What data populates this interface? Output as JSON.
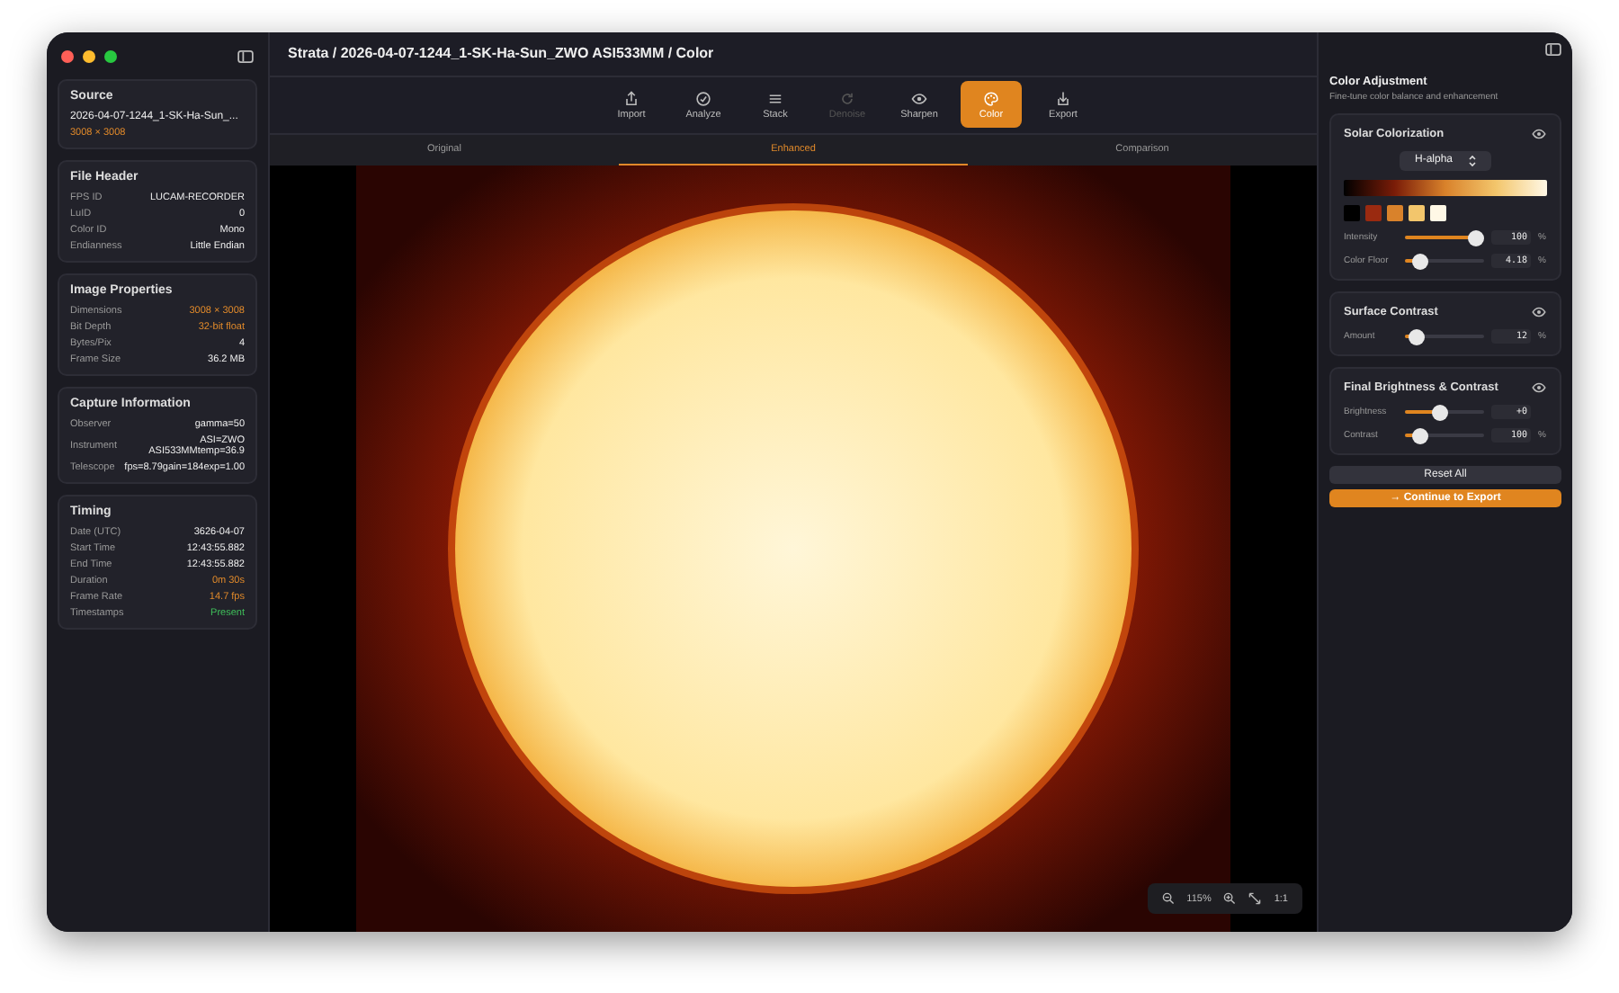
{
  "window": {
    "title": "Strata / 2026-04-07-1244_1-SK-Ha-Sun_ZWO ASI533MM / Color"
  },
  "sidebar": {
    "cards": [
      {
        "title": "Source",
        "file": "2026-04-07-1244_1-SK-Ha-Sun_...",
        "size": "3008 × 3008"
      },
      {
        "title": "File Header",
        "rows": [
          {
            "label": "FPS ID",
            "value": "LUCAM-RECORDER"
          },
          {
            "label": "LuID",
            "value": "0"
          },
          {
            "label": "Color ID",
            "value": "Mono"
          },
          {
            "label": "Endianness",
            "value": "Little Endian"
          }
        ]
      },
      {
        "title": "Image Properties",
        "rows": [
          {
            "label": "Dimensions",
            "value": "3008 × 3008",
            "color": "#e0892a"
          },
          {
            "label": "Bit Depth",
            "value": "32-bit float",
            "color": "#e0892a"
          },
          {
            "label": "Bytes/Pix",
            "value": "4"
          },
          {
            "label": "Frame Size",
            "value": "36.2 MB"
          }
        ]
      },
      {
        "title": "Capture Information",
        "rows": [
          {
            "label": "Observer",
            "value": "gamma=50"
          },
          {
            "label": "Instrument",
            "value": "ASI=ZWO ASI533MMtemp=36.9"
          },
          {
            "label": "Telescope",
            "value": "fps=8.79gain=184exp=1.00"
          }
        ]
      },
      {
        "title": "Timing",
        "rows": [
          {
            "label": "Date (UTC)",
            "value": "3626-04-07"
          },
          {
            "label": "Start Time",
            "value": "12:43:55.882"
          },
          {
            "label": "End Time",
            "value": "12:43:55.882"
          },
          {
            "label": "Duration",
            "value": "0m 30s",
            "color": "#e0892a"
          },
          {
            "label": "Frame Rate",
            "value": "14.7 fps",
            "color": "#e0892a"
          },
          {
            "label": "Timestamps",
            "value": "Present",
            "color": "#3fbf5a"
          }
        ]
      }
    ]
  },
  "toolbar": [
    {
      "label": "Import",
      "selected": false,
      "disabled": false
    },
    {
      "label": "Analyze",
      "selected": false,
      "disabled": false
    },
    {
      "label": "Stack",
      "selected": false,
      "disabled": false
    },
    {
      "label": "Denoise",
      "selected": false,
      "disabled": true
    },
    {
      "label": "Sharpen",
      "selected": false,
      "disabled": false
    },
    {
      "label": "Color",
      "selected": true,
      "disabled": false
    },
    {
      "label": "Export",
      "selected": false,
      "disabled": false
    }
  ],
  "view_tabs": [
    {
      "label": "Original",
      "selected": false
    },
    {
      "label": "Enhanced",
      "selected": true
    },
    {
      "label": "Comparison",
      "selected": false
    }
  ],
  "zoom_bar": {
    "zoom": "115%",
    "actual_size": "1:1"
  },
  "panel": {
    "title": "Color Adjustment",
    "subtitle": "Fine-tune color balance and enhancement",
    "sections": [
      {
        "title": "Solar Colorization",
        "preset": "H-alpha",
        "swatches": [
          {
            "color": "#000000"
          },
          {
            "color": "#9a2a10"
          },
          {
            "color": "#d9822b"
          },
          {
            "color": "#f3c66c"
          },
          {
            "color": "#fff8e6"
          }
        ],
        "sliders": [
          {
            "label": "Intensity",
            "level": 0.9,
            "value": "100",
            "unit": "%"
          },
          {
            "label": "Color Floor",
            "level": 0.2,
            "value": "4.18",
            "unit": "%"
          }
        ]
      },
      {
        "title": "Surface Contrast",
        "sliders": [
          {
            "label": "Amount",
            "level": 0.15,
            "value": "12",
            "unit": "%"
          }
        ]
      },
      {
        "title": "Final Brightness & Contrast",
        "sliders": [
          {
            "label": "Brightness",
            "level": 0.45,
            "value": "+0"
          },
          {
            "label": "Contrast",
            "level": 0.2,
            "value": "100",
            "unit": "%"
          }
        ]
      }
    ],
    "reset": "Reset All",
    "continue": "→ Continue to Export"
  }
}
